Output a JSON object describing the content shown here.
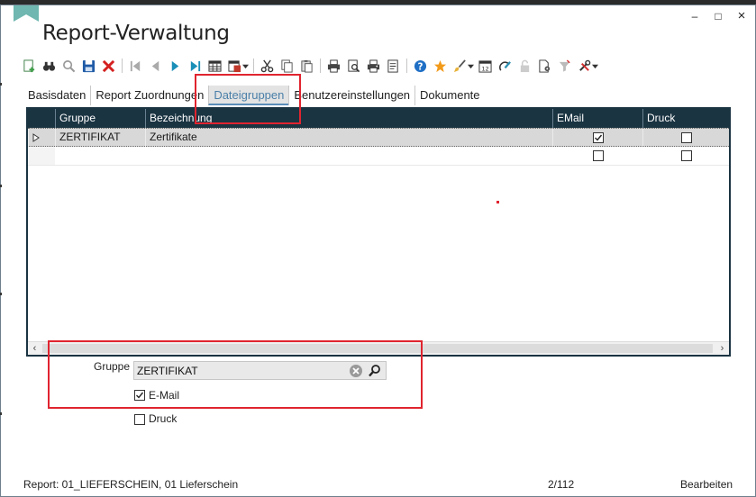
{
  "window": {
    "title": "Report-Verwaltung",
    "controls": {
      "minimize": "–",
      "maximize": "□",
      "close": "×"
    }
  },
  "toolbar": {
    "buttons": [
      "new-record-icon",
      "binoculars-icon",
      "search-icon",
      "save-icon",
      "delete-icon",
      "first-record-icon",
      "previous-record-icon",
      "next-record-icon",
      "last-record-icon",
      "table-view-icon",
      "export-icon",
      "cut-icon",
      "copy-icon",
      "paste-icon",
      "print-icon",
      "print-preview-icon",
      "print-setup-icon",
      "print-list-icon",
      "help-icon",
      "favorite-star-icon",
      "brush-icon",
      "calendar-icon",
      "edit-note-icon",
      "lock-icon",
      "document-settings-icon",
      "filter-icon",
      "tools-icon"
    ]
  },
  "tabs": [
    {
      "label": "Basisdaten",
      "active": false
    },
    {
      "label": "Report Zuordnungen",
      "active": false
    },
    {
      "label": "Dateigruppen",
      "active": true
    },
    {
      "label": "Benutzereinstellungen",
      "active": false
    },
    {
      "label": "Dokumente",
      "active": false
    }
  ],
  "grid": {
    "columns": [
      "Gruppe",
      "Bezeichnung",
      "EMail",
      "Druck"
    ],
    "rows": [
      {
        "gruppe": "ZERTIFIKAT",
        "bezeichnung": "Zertifikate",
        "email": true,
        "druck": false,
        "selected": true
      },
      {
        "gruppe": "",
        "bezeichnung": "",
        "email": false,
        "druck": false,
        "selected": false
      }
    ]
  },
  "form": {
    "gruppe_label": "Gruppe",
    "gruppe_value": "ZERTIFIKAT",
    "email_label": "E-Mail",
    "email_checked": true,
    "druck_label": "Druck",
    "druck_checked": false
  },
  "status": {
    "report": "Report: 01_LIEFERSCHEIN, 01 Lieferschein",
    "position": "2/112",
    "mode": "Bearbeiten"
  },
  "colors": {
    "grid_header": "#1b3442",
    "tab_active_text": "#4a7fa8",
    "highlight_red": "#e0242f",
    "bookmark_teal": "#6fb7b0"
  }
}
